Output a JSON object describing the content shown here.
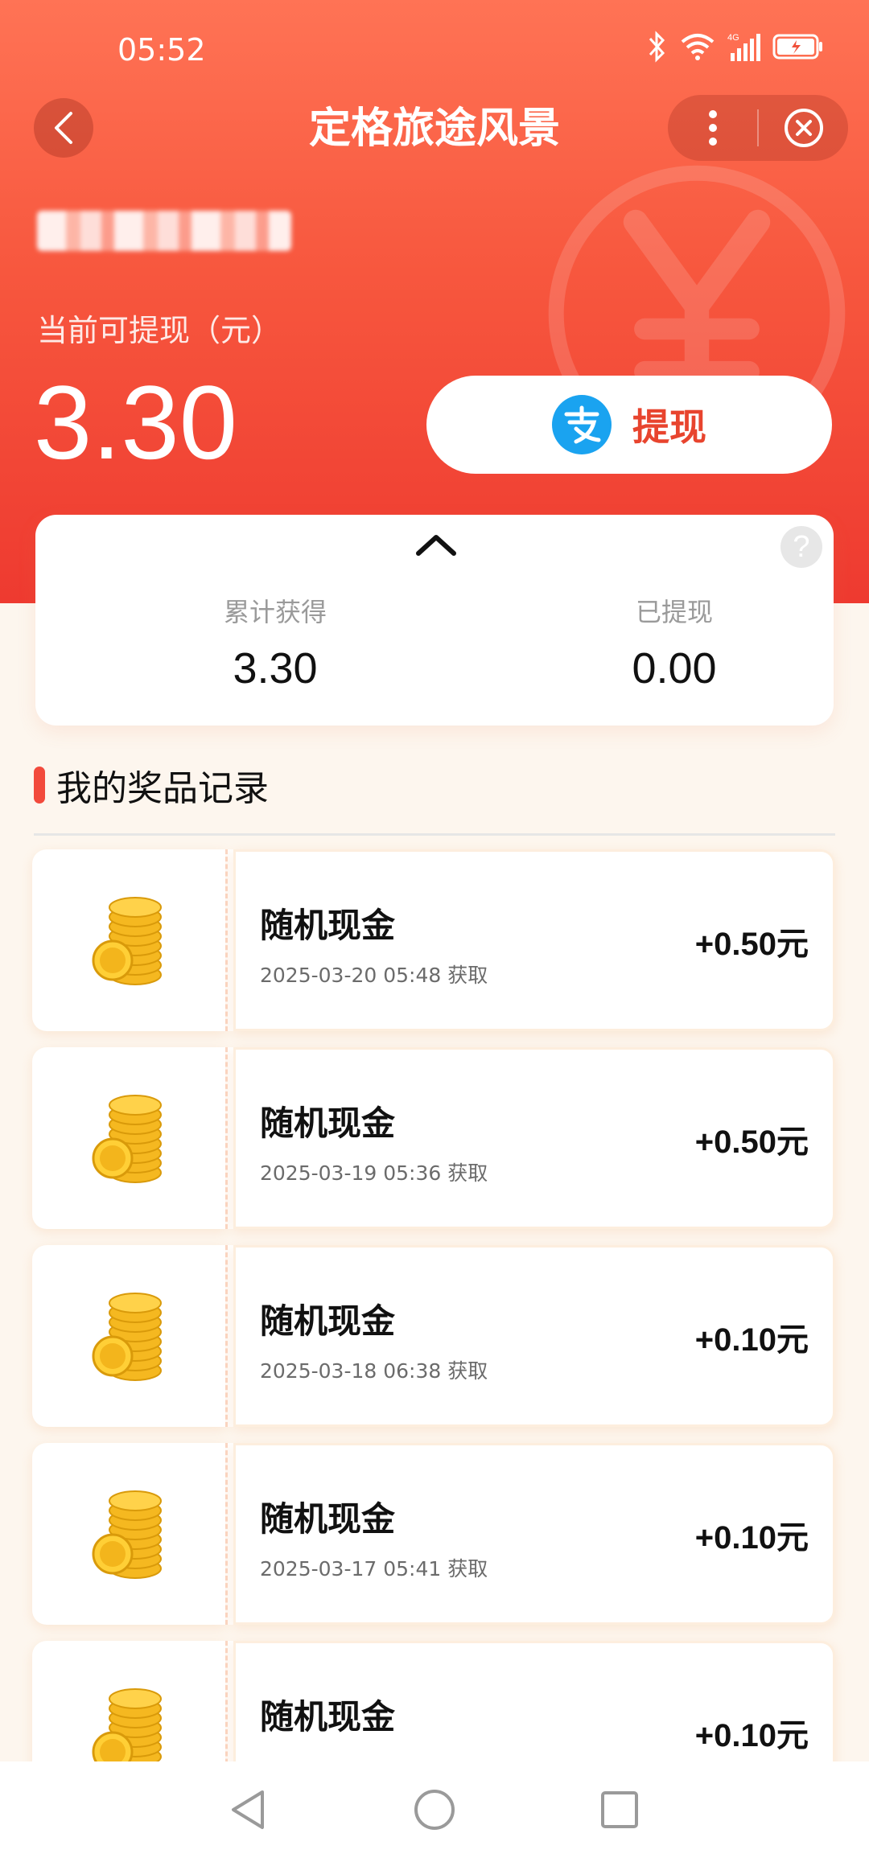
{
  "status_bar": {
    "time": "05:52"
  },
  "header": {
    "title": "定格旅途风景"
  },
  "account": {
    "withdraw_label": "当前可提现（元）",
    "balance": "3.30",
    "withdraw_button": "提现"
  },
  "stats": {
    "earned_label": "累计获得",
    "earned_value": "3.30",
    "withdrawn_label": "已提现",
    "withdrawn_value": "0.00"
  },
  "section": {
    "title": "我的奖品记录"
  },
  "records": [
    {
      "title": "随机现金",
      "time": "2025-03-20 05:48 获取",
      "amount": "+0.50元"
    },
    {
      "title": "随机现金",
      "time": "2025-03-19 05:36 获取",
      "amount": "+0.50元"
    },
    {
      "title": "随机现金",
      "time": "2025-03-18 06:38 获取",
      "amount": "+0.10元"
    },
    {
      "title": "随机现金",
      "time": "2025-03-17 05:41 获取",
      "amount": "+0.10元"
    },
    {
      "title": "随机现金",
      "time": "",
      "amount": "+0.10元"
    }
  ],
  "colors": {
    "hero_top": "#ff7355",
    "hero_bottom": "#ee3a30",
    "accent": "#e8442e",
    "alipay_blue": "#1aa3f0"
  },
  "icons": {
    "back": "chevron-left-icon",
    "more": "more-vertical-icon",
    "close": "close-circle-icon",
    "alipay": "alipay-icon",
    "coin": "gold-coin-stack-icon",
    "help": "help-icon"
  }
}
